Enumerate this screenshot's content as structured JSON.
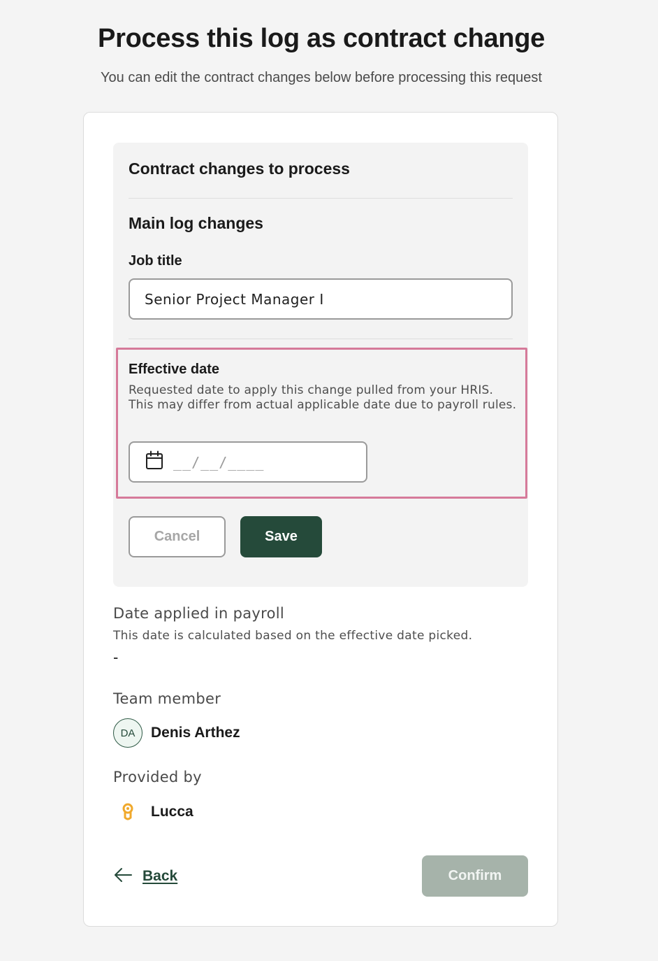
{
  "page": {
    "title": "Process this log as contract change",
    "subtitle": "You can edit the contract changes below before processing this request"
  },
  "panel": {
    "heading": "Contract changes to process",
    "section_heading": "Main log changes",
    "job_title": {
      "label": "Job title",
      "value": "Senior Project Manager I"
    },
    "effective_date": {
      "label": "Effective date",
      "help": "Requested date to apply this change pulled from your HRIS. This may differ from actual applicable date due to payroll rules.",
      "placeholder": "__/__/____",
      "icon": "calendar-icon"
    },
    "cancel_label": "Cancel",
    "save_label": "Save"
  },
  "payroll_date": {
    "label": "Date applied in payroll",
    "help": "This date is calculated based on the effective date picked.",
    "value": "-"
  },
  "team_member": {
    "label": "Team member",
    "initials": "DA",
    "name": "Denis Arthez"
  },
  "provider": {
    "label": "Provided by",
    "name": "Lucca",
    "icon": "lucca-logo-icon"
  },
  "footer": {
    "back_label": "Back",
    "back_icon": "arrow-left-icon",
    "confirm_label": "Confirm"
  },
  "colors": {
    "primary": "#254a3a",
    "highlight_border": "#d67a9a",
    "disabled_button": "#a6b3aa",
    "provider_logo": "#f0a92c"
  }
}
